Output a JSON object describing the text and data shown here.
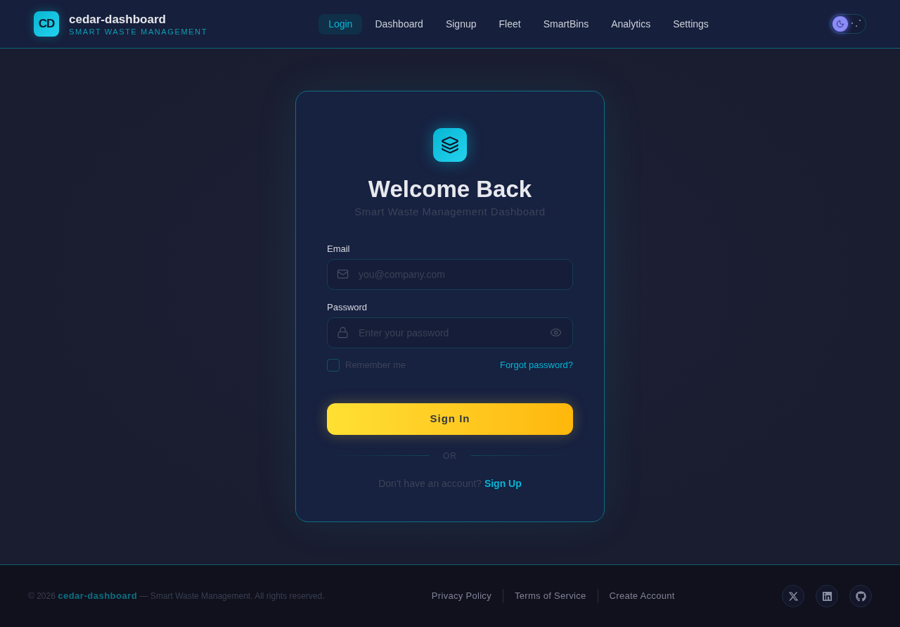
{
  "header": {
    "logo_initials": "CD",
    "name": "cedar-dashboard",
    "tagline": "SMART WASTE MANAGEMENT",
    "theme_toggle": {
      "light_mode": false
    }
  },
  "nav": {
    "items": [
      {
        "label": "Login",
        "selected": true
      },
      {
        "label": "Dashboard",
        "selected": false
      },
      {
        "label": "Signup",
        "selected": false
      },
      {
        "label": "Fleet",
        "selected": false
      },
      {
        "label": "SmartBins",
        "selected": false
      },
      {
        "label": "Analytics",
        "selected": false
      },
      {
        "label": "Settings",
        "selected": false
      }
    ]
  },
  "login_card": {
    "title": "Welcome Back",
    "subtitle": "Smart Waste Management Dashboard",
    "fields": [
      {
        "kind": "email",
        "label": "Email",
        "placeholder": "you@company.com"
      },
      {
        "kind": "password",
        "label": "Password",
        "placeholder": "Enter your password"
      }
    ],
    "remember_me": {
      "label": "Remember me",
      "checked": false
    },
    "forgot_password": "Forgot password?",
    "submit": "Sign In",
    "divider": "OR",
    "signup_prompt": "Don't have an account?",
    "signup_link": "Sign Up"
  },
  "footer": {
    "copyright": "© 2026 **cedar-dashboard** — Smart Waste Management. All rights reserved.",
    "links": [
      "Privacy Policy",
      "Terms of Service",
      "Create Account"
    ],
    "social_links": [
      {
        "kind": "x"
      },
      {
        "kind": "linkedin"
      },
      {
        "kind": "github"
      }
    ]
  }
}
